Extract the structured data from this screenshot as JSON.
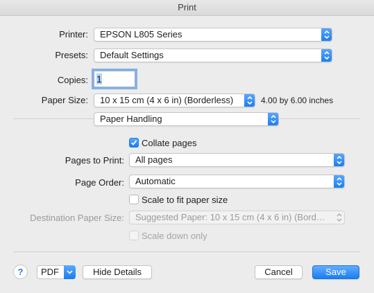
{
  "window": {
    "title": "Print"
  },
  "printer": {
    "label": "Printer:",
    "value": "EPSON L805 Series"
  },
  "presets": {
    "label": "Presets:",
    "value": "Default Settings"
  },
  "copies": {
    "label": "Copies:",
    "value": "1"
  },
  "paper_size": {
    "label": "Paper Size:",
    "value": "10 x 15 cm (4 x 6 in) (Borderless)",
    "dimensions": "4.00 by 6.00 inches"
  },
  "section": {
    "value": "Paper Handling"
  },
  "collate": {
    "label": "Collate pages",
    "checked": true
  },
  "pages_to_print": {
    "label": "Pages to Print:",
    "value": "All pages"
  },
  "page_order": {
    "label": "Page Order:",
    "value": "Automatic"
  },
  "scale_to_fit": {
    "label": "Scale to fit paper size",
    "checked": false
  },
  "destination_paper_size": {
    "label": "Destination Paper Size:",
    "value": "Suggested Paper: 10 x 15 cm (4 x 6 in) (Border…",
    "disabled": true
  },
  "scale_down": {
    "label": "Scale down only",
    "checked": false,
    "disabled": true
  },
  "footer": {
    "help": "?",
    "pdf": "PDF",
    "hide_details": "Hide Details",
    "cancel": "Cancel",
    "save": "Save"
  },
  "colors": {
    "accent": "#1a7cf0",
    "background": "#ececec"
  }
}
